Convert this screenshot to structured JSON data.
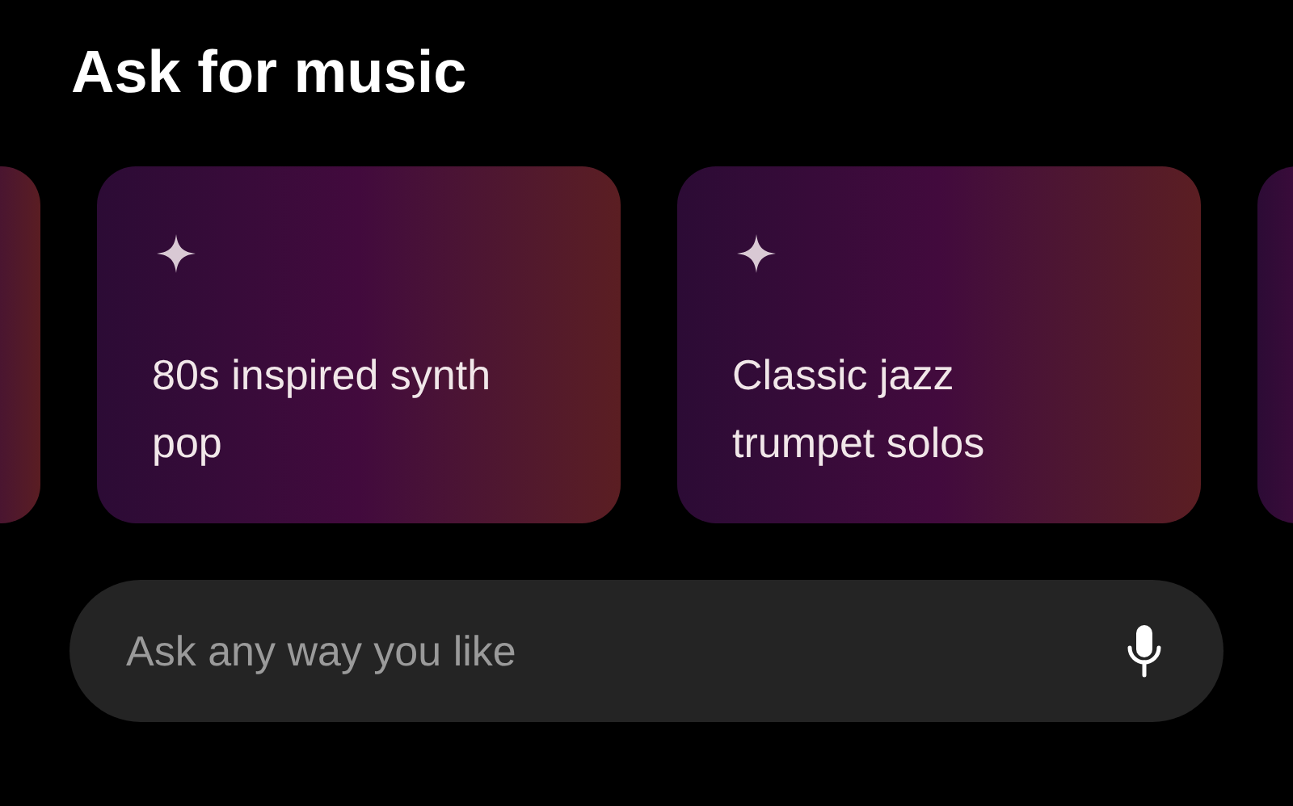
{
  "heading": "Ask for music",
  "suggestions": [
    {
      "text": "80s inspired synth pop"
    },
    {
      "text": "Classic jazz trumpet solos"
    }
  ],
  "search": {
    "placeholder": "Ask any way you like"
  }
}
